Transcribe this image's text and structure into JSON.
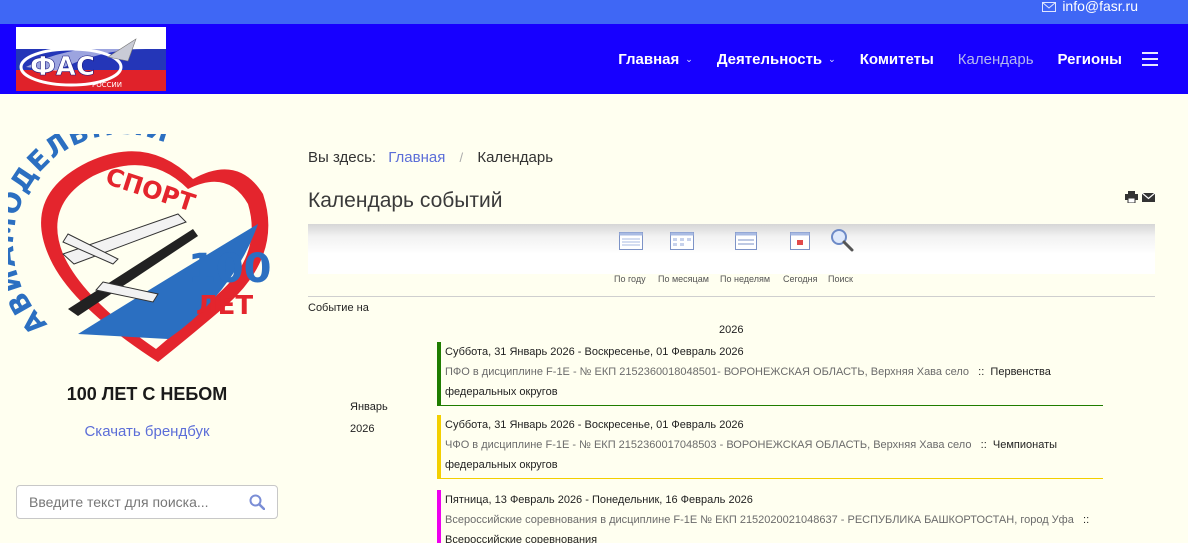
{
  "topbar": {
    "email": "info@fasr.ru"
  },
  "logo": {
    "text": "ФАС",
    "subtext": "РОССИИ"
  },
  "nav": {
    "items": [
      {
        "label": "Главная",
        "dropdown": true
      },
      {
        "label": "Деятельность",
        "dropdown": true
      },
      {
        "label": "Комитеты",
        "dropdown": false
      },
      {
        "label": "Календарь",
        "dropdown": false,
        "active": true
      },
      {
        "label": "Регионы",
        "dropdown": false
      }
    ],
    "chevron": "⌄"
  },
  "sidebar": {
    "emblem": {
      "arc_text": "АВИАМОДЕЛЬНЫЙ",
      "sport_text": "СПОРТ",
      "number": "100",
      "years": "ЛЕТ"
    },
    "slogan": "100 ЛЕТ С НЕБОМ",
    "brandbook_link": "Скачать брендбук",
    "search_placeholder": "Введите текст для поиска..."
  },
  "breadcrumb": {
    "label": "Вы здесь:",
    "home": "Главная",
    "separator": "/",
    "current": "Календарь"
  },
  "page_title": "Календарь событий",
  "toolbar": {
    "by_year": "По году",
    "by_month": "По месяцам",
    "by_week": "По неделям",
    "today": "Сегодня",
    "search": "Поиск"
  },
  "listing": {
    "event_on": "Событие на",
    "year": "2026",
    "month": "Январь",
    "month_year": "2026",
    "events": [
      {
        "date": "Суббота, 31 Январь 2026 - Воскресенье, 01 Февраль 2026",
        "desc": "ПФО в дисциплине F-1E - № ЕКП 2152360018048501- ВОРОНЕЖСКАЯ ОБЛАСТЬ, Верхняя Хава село",
        "sep": "::",
        "category": "Первенства федеральных округов",
        "color": "#1f7d00"
      },
      {
        "date": "Суббота, 31 Январь 2026 - Воскресенье, 01 Февраль 2026",
        "desc": "ЧФО в дисциплине F-1E - № ЕКП 2152360017048503 - ВОРОНЕЖСКАЯ ОБЛАСТЬ, Верхняя Хава село",
        "sep": "::",
        "category": "Чемпионаты федеральных округов",
        "color": "#f3cf00"
      },
      {
        "date": "Пятница, 13 Февраль 2026 - Понедельник, 16 Февраль 2026",
        "desc": "Всероссийские соревнования в дисциплине F-1E № ЕКП 2152020021048637 - РЕСПУБЛИКА БАШКОРТОСТАН, город Уфа",
        "sep": "::",
        "category": "Всероссийские соревнования",
        "color": "#ee00ee"
      }
    ]
  }
}
